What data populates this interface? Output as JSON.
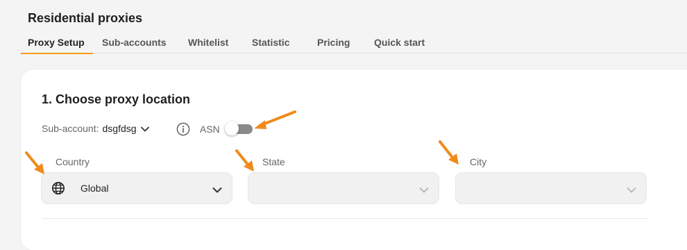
{
  "header": {
    "title": "Residential proxies"
  },
  "tabs": [
    {
      "label": "Proxy Setup",
      "active": true
    },
    {
      "label": "Sub-accounts",
      "active": false
    },
    {
      "label": "Whitelist",
      "active": false
    },
    {
      "label": "Statistic",
      "active": false
    },
    {
      "label": "Pricing",
      "active": false
    },
    {
      "label": "Quick start",
      "active": false
    }
  ],
  "section": {
    "title": "1. Choose proxy location"
  },
  "subaccount": {
    "label": "Sub-account:",
    "value": "dsgfdsg"
  },
  "asn": {
    "label": "ASN",
    "enabled": false
  },
  "location": {
    "country": {
      "label": "Country",
      "value": "Global",
      "icon": "globe-icon"
    },
    "state": {
      "label": "State",
      "value": ""
    },
    "city": {
      "label": "City",
      "value": ""
    }
  },
  "colors": {
    "accent": "#f39c12",
    "annotation_arrow": "#f08a1c"
  }
}
